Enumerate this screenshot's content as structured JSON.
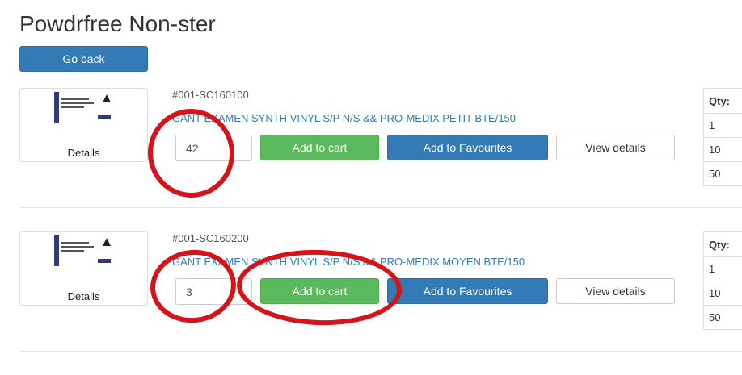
{
  "page": {
    "title": "Powdrfree Non-ster",
    "back_label": "Go back"
  },
  "products": [
    {
      "sku": "#001-SC160100",
      "name": "GANT EXAMEN SYNTH VINYL S/P N/S && PRO-MEDIX PETIT BTE/150",
      "details_label": "Details",
      "qty_value": "42",
      "add_to_cart_label": "Add to cart",
      "add_to_fav_label": "Add to Favourites",
      "view_details_label": "View details",
      "qty_table": {
        "header": "Qty:",
        "rows": [
          "1",
          "10",
          "50"
        ]
      }
    },
    {
      "sku": "#001-SC160200",
      "name": "GANT EXAMEN SYNTH VINYL S/P N/S && PRO-MEDIX MOYEN BTE/150",
      "details_label": "Details",
      "qty_value": "3",
      "add_to_cart_label": "Add to cart",
      "add_to_fav_label": "Add to Favourites",
      "view_details_label": "View details",
      "qty_table": {
        "header": "Qty:",
        "rows": [
          "1",
          "10",
          "50"
        ]
      }
    }
  ],
  "colors": {
    "primary": "#337ab7",
    "success": "#5cb85c",
    "annotation": "#d4131a"
  }
}
